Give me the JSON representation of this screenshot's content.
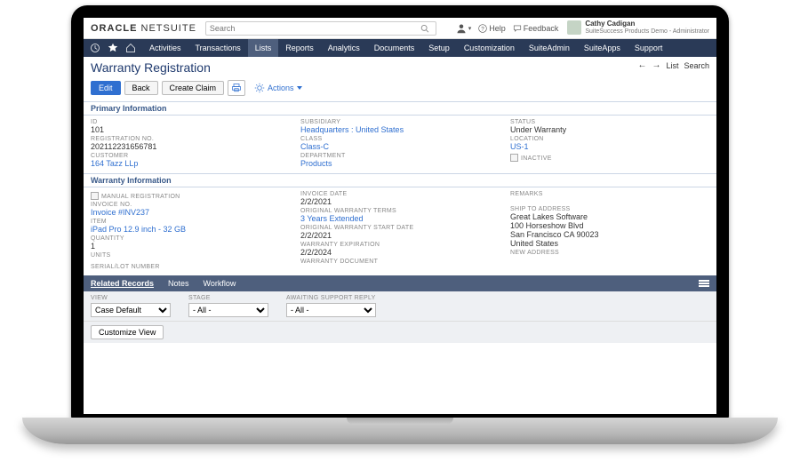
{
  "header": {
    "logo_bold": "ORACLE",
    "logo_thin": " NETSUITE",
    "search_placeholder": "Search",
    "help": "Help",
    "feedback": "Feedback",
    "user_name": "Cathy Cadigan",
    "user_sub": "SuiteSuccess Products Demo - Administrator"
  },
  "nav": {
    "items": [
      "Activities",
      "Transactions",
      "Lists",
      "Reports",
      "Analytics",
      "Documents",
      "Setup",
      "Customization",
      "SuiteAdmin",
      "SuiteApps",
      "Support"
    ],
    "active_index": 2
  },
  "page": {
    "title": "Warranty Registration",
    "right_list": "List",
    "right_search": "Search"
  },
  "toolbar": {
    "edit": "Edit",
    "back": "Back",
    "create_claim": "Create Claim",
    "actions": "Actions"
  },
  "sections": {
    "primary": "Primary Information",
    "warranty": "Warranty Information"
  },
  "primary": {
    "col1": {
      "id_lbl": "ID",
      "id": "101",
      "reg_lbl": "REGISTRATION NO.",
      "reg": "202112231656781",
      "cust_lbl": "CUSTOMER",
      "cust": "164 Tazz LLp"
    },
    "col2": {
      "sub_lbl": "SUBSIDIARY",
      "sub": "Headquarters : United States",
      "class_lbl": "CLASS",
      "class": "Class-C",
      "dept_lbl": "DEPARTMENT",
      "dept": "Products"
    },
    "col3": {
      "status_lbl": "STATUS",
      "status": "Under Warranty",
      "loc_lbl": "LOCATION",
      "loc": "US-1",
      "inactive_lbl": "INACTIVE"
    }
  },
  "warranty": {
    "col1": {
      "manual_lbl": "MANUAL REGISTRATION",
      "inv_lbl": "INVOICE NO.",
      "inv": "Invoice #INV237",
      "item_lbl": "ITEM",
      "item": "iPad Pro 12.9 inch - 32 GB",
      "qty_lbl": "QUANTITY",
      "qty": "1",
      "units_lbl": "UNITS",
      "serial_lbl": "SERIAL/LOT NUMBER"
    },
    "col2": {
      "invdate_lbl": "INVOICE DATE",
      "invdate": "2/2/2021",
      "terms_lbl": "ORIGINAL WARRANTY TERMS",
      "terms": "3 Years Extended",
      "start_lbl": "ORIGINAL WARRANTY START DATE",
      "start": "2/2/2021",
      "exp_lbl": "WARRANTY EXPIRATION",
      "exp": "2/2/2024",
      "doc_lbl": "WARRANTY DOCUMENT"
    },
    "col3": {
      "remarks_lbl": "REMARKS",
      "ship_lbl": "SHIP TO ADDRESS",
      "ship1": "Great Lakes Software",
      "ship2": "100 Horseshow Blvd",
      "ship3": "San Francisco CA 90023",
      "ship4": "United States",
      "newaddr_lbl": "NEW ADDRESS"
    }
  },
  "subtabs": {
    "tabs": [
      "Related Records",
      "Notes",
      "Workflow"
    ],
    "active_index": 0
  },
  "filters": {
    "view_lbl": "VIEW",
    "view_opt": "Case Default",
    "stage_lbl": "STAGE",
    "stage_opt": "- All -",
    "reply_lbl": "AWAITING SUPPORT REPLY",
    "reply_opt": "- All -"
  },
  "customize": "Customize View"
}
